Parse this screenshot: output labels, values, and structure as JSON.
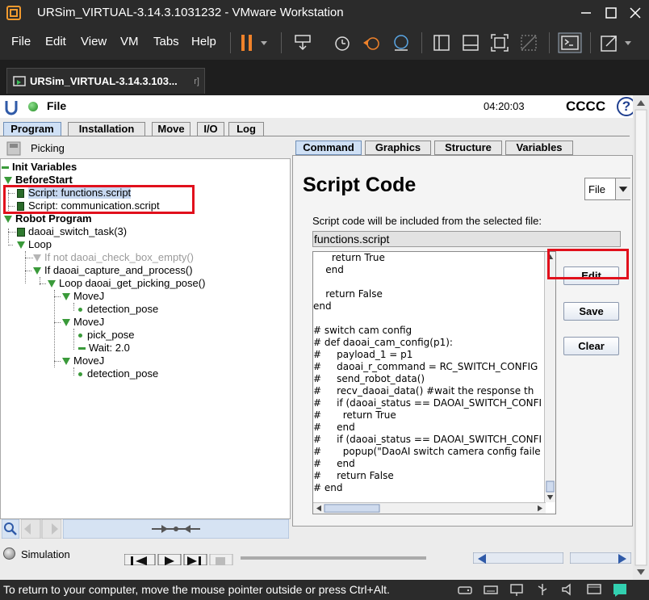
{
  "window": {
    "title": "URSim_VIRTUAL-3.14.3.1031232 - VMware Workstation"
  },
  "menubar": {
    "items": [
      "File",
      "Edit",
      "View",
      "VM",
      "Tabs",
      "Help"
    ]
  },
  "vm_tab": {
    "label": "URSim_VIRTUAL-3.14.3.103...",
    "close_glyph": "r]"
  },
  "ur_header": {
    "file_label": "File",
    "clock": "04:20:03",
    "robot_name": "CCCC",
    "help_glyph": "?"
  },
  "main_tabs": [
    {
      "label": "Program",
      "active": true
    },
    {
      "label": "Installation",
      "active": false
    },
    {
      "label": "Move",
      "active": false
    },
    {
      "label": "I/O",
      "active": false
    },
    {
      "label": "Log",
      "active": false
    }
  ],
  "left": {
    "picking_label": "Picking"
  },
  "tree": [
    {
      "text": "Init Variables",
      "bold": true,
      "icon": "green-bar"
    },
    {
      "text": "BeforeStart",
      "bold": true,
      "icon": "triangle"
    },
    {
      "text": "Script: functions.script",
      "icon": "script",
      "selected": true
    },
    {
      "text": "Script: communication.script",
      "icon": "script"
    },
    {
      "text": "Robot Program",
      "bold": true,
      "icon": "triangle"
    },
    {
      "text": "daoai_switch_task(3)",
      "icon": "call"
    },
    {
      "text": "Loop",
      "icon": "triangle"
    },
    {
      "text": "If  not daoai_check_box_empty()",
      "icon": "triangle-grey",
      "disabled": true
    },
    {
      "text": "If daoai_capture_and_process()",
      "icon": "triangle"
    },
    {
      "text": "Loop daoai_get_picking_pose()",
      "icon": "triangle"
    },
    {
      "text": "MoveJ",
      "icon": "triangle"
    },
    {
      "text": "detection_pose",
      "icon": "dot"
    },
    {
      "text": "MoveJ",
      "icon": "triangle"
    },
    {
      "text": "pick_pose",
      "icon": "dot"
    },
    {
      "text": "Wait: 2.0",
      "icon": "green-bar"
    },
    {
      "text": "MoveJ",
      "icon": "triangle"
    },
    {
      "text": "detection_pose",
      "icon": "dot"
    }
  ],
  "sub_tabs": [
    {
      "label": "Command",
      "active": true
    },
    {
      "label": "Graphics",
      "active": false
    },
    {
      "label": "Structure",
      "active": false
    },
    {
      "label": "Variables",
      "active": false
    }
  ],
  "script": {
    "title": "Script Code",
    "source_select": "File",
    "hint": "Script code will be included from the selected file:",
    "filename": "functions.script",
    "code_lines": [
      "      return True",
      "    end",
      "",
      "    return False",
      "end",
      "",
      "# switch cam config",
      "# def daoai_cam_config(p1):",
      "#     payload_1 = p1",
      "#     daoai_r_command = RC_SWITCH_CONFIG",
      "#     send_robot_data()",
      "#     recv_daoai_data() #wait the response th",
      "#     if (daoai_status == DAOAI_SWITCH_CONFI",
      "#       return True",
      "#     end",
      "#     if (daoai_status == DAOAI_SWITCH_CONFI",
      "#       popup(\"DaoAI switch camera config faile",
      "#     end",
      "#     return False",
      "# end"
    ],
    "buttons": {
      "edit": "Edit",
      "save": "Save",
      "clear": "Clear"
    }
  },
  "bottom": {
    "simulation_label": "Simulation"
  },
  "statusbar": {
    "message": "To return to your computer, move the mouse pointer outside or press Ctrl+Alt."
  },
  "colors": {
    "vmware_chrome": "#2b2b2b",
    "highlight_red": "#e1101c",
    "active_tab": "#cfe0f5",
    "tree_green": "#3a9a3a",
    "pause_orange": "#f0822a"
  }
}
